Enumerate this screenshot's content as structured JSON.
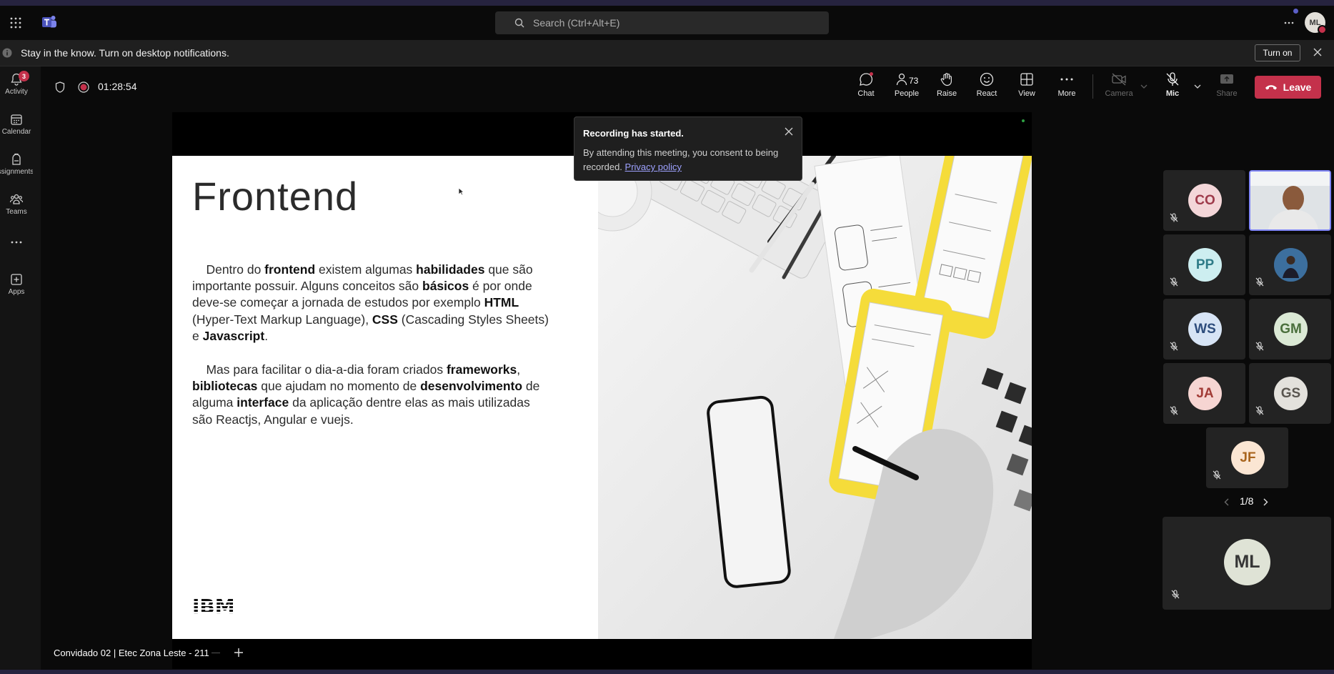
{
  "search": {
    "placeholder": "Search (Ctrl+Alt+E)"
  },
  "user": {
    "initials": "ML"
  },
  "notification": {
    "text": "Stay in the know. Turn on desktop notifications.",
    "turn_on": "Turn on"
  },
  "rail": {
    "activity": {
      "label": "Activity",
      "badge": "3"
    },
    "calendar": "Calendar",
    "assignments": "Assignments",
    "teams": "Teams",
    "apps": "Apps"
  },
  "meeting": {
    "timer": "01:28:54",
    "toolbar": {
      "chat": "Chat",
      "people": "People",
      "people_count": "73",
      "raise": "Raise",
      "react": "React",
      "view": "View",
      "more": "More",
      "camera": "Camera",
      "mic": "Mic",
      "share": "Share",
      "leave": "Leave"
    }
  },
  "recording_toast": {
    "title": "Recording has started.",
    "body": "By attending this meeting, you consent to being recorded.",
    "link": "Privacy policy"
  },
  "slide": {
    "title": "Frontend",
    "p1": [
      {
        "t": "Dentro do ",
        "b": false
      },
      {
        "t": "frontend",
        "b": true
      },
      {
        "t": " existem algumas ",
        "b": false
      },
      {
        "t": "habilidades",
        "b": true
      },
      {
        "t": " que são importante possuir. Alguns conceitos são ",
        "b": false
      },
      {
        "t": "básicos",
        "b": true
      },
      {
        "t": " é por onde deve-se começar a jornada de estudos por exemplo ",
        "b": false
      },
      {
        "t": "HTML",
        "b": true
      },
      {
        "t": " (Hyper-Text Markup Language), ",
        "b": false
      },
      {
        "t": "CSS",
        "b": true
      },
      {
        "t": " (Cascading Styles Sheets) e ",
        "b": false
      },
      {
        "t": "Javascript",
        "b": true
      },
      {
        "t": ".",
        "b": false
      }
    ],
    "p2": [
      {
        "t": "Mas para facilitar o dia-a-dia foram criados ",
        "b": false
      },
      {
        "t": "frameworks",
        "b": true
      },
      {
        "t": ", ",
        "b": false
      },
      {
        "t": "bibliotecas",
        "b": true
      },
      {
        "t": " que ajudam no momento de ",
        "b": false
      },
      {
        "t": "desenvolvimento",
        "b": true
      },
      {
        "t": " de alguma ",
        "b": false
      },
      {
        "t": "interface",
        "b": true
      },
      {
        "t": " da aplicação dentre elas as mais utilizadas são Reactjs, Angular e vuejs.",
        "b": false
      }
    ],
    "logo_text": "IBM"
  },
  "presenter_label": "Convidado 02 | Etec Zona Leste - 211",
  "participants": [
    {
      "initials": "CO",
      "bg": "#f3d6d8",
      "fg": "#9e3a4a"
    },
    {
      "initials": "",
      "video": true
    },
    {
      "initials": "PP",
      "bg": "#cdeef0",
      "fg": "#2f7c88"
    },
    {
      "initials": "",
      "photo": true
    },
    {
      "initials": "WS",
      "bg": "#d7e4f5",
      "fg": "#2d4c7c"
    },
    {
      "initials": "GM",
      "bg": "#dbe9d5",
      "fg": "#4a6f3c"
    },
    {
      "initials": "JA",
      "bg": "#f6d5d2",
      "fg": "#a23c37"
    },
    {
      "initials": "GS",
      "bg": "#e3e1dc",
      "fg": "#5a5650"
    },
    {
      "initials": "JF",
      "bg": "#fbe6d3",
      "fg": "#a9651e"
    }
  ],
  "pager": "1/8",
  "self_tile": {
    "initials": "ML"
  }
}
